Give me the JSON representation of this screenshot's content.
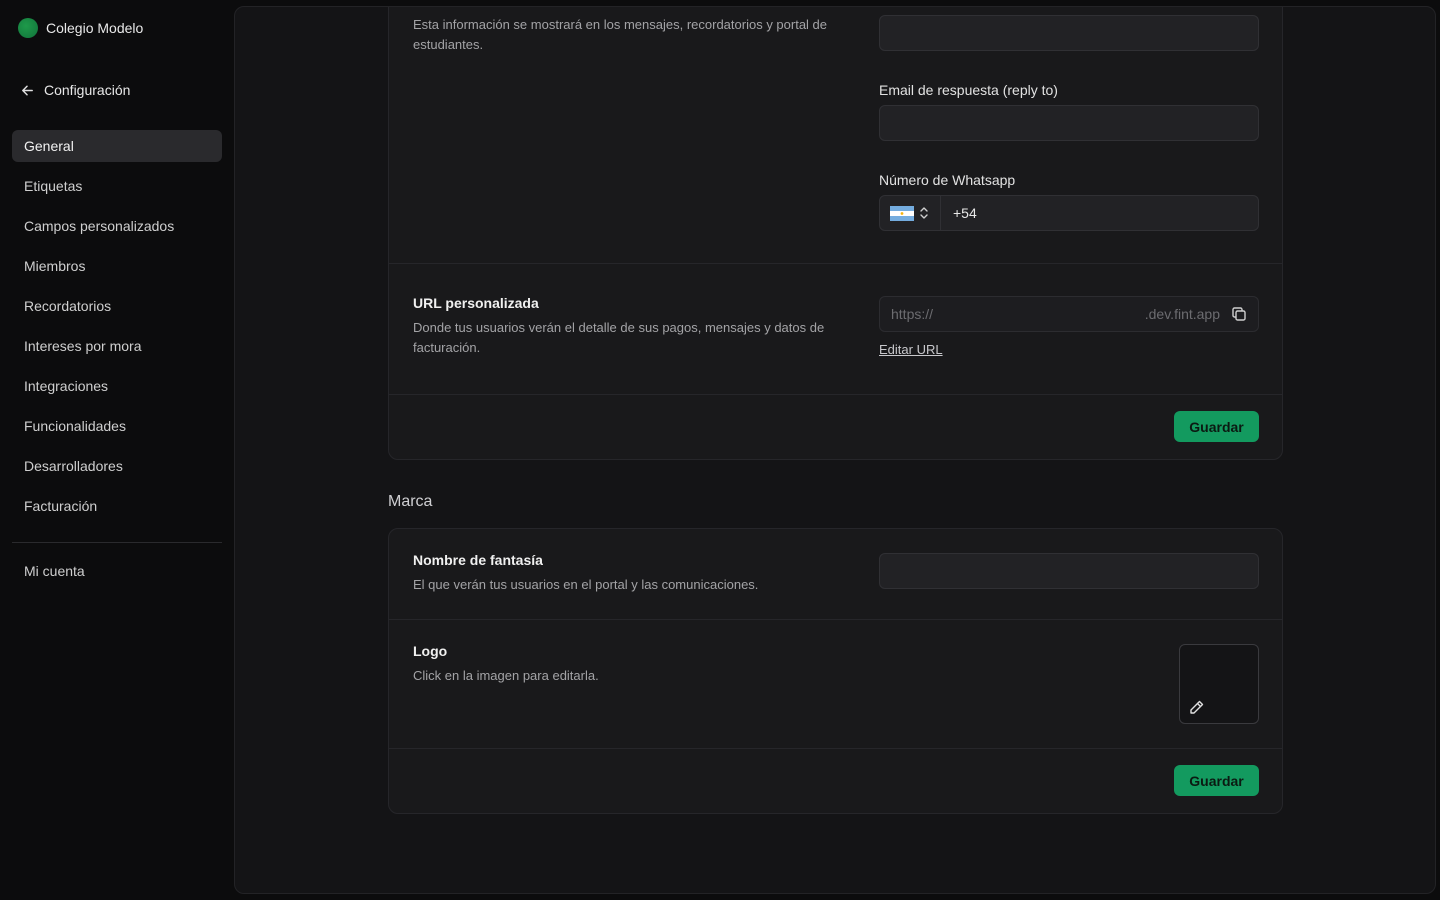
{
  "sidebar": {
    "org_name": "Colegio Modelo",
    "back_label": "Configuración",
    "items": [
      {
        "label": "General",
        "active": true
      },
      {
        "label": "Etiquetas"
      },
      {
        "label": "Campos personalizados"
      },
      {
        "label": "Miembros"
      },
      {
        "label": "Recordatorios"
      },
      {
        "label": "Intereses por mora"
      },
      {
        "label": "Integraciones"
      },
      {
        "label": "Funcionalidades"
      },
      {
        "label": "Desarrolladores"
      },
      {
        "label": "Facturación"
      }
    ],
    "account_label": "Mi cuenta"
  },
  "contact": {
    "description": "Esta información se mostrará en los mensajes, recordatorios y portal de estudiantes.",
    "email_field_value": "",
    "reply_to_label": "Email de respuesta (reply to)",
    "reply_to_value": "",
    "whatsapp_label": "Número de Whatsapp",
    "whatsapp_country": "Argentina",
    "whatsapp_value": "+54"
  },
  "custom_url": {
    "title": "URL personalizada",
    "description": "Donde tus usuarios verán el detalle de sus pagos, mensajes y datos de facturación.",
    "prefix": "https://",
    "suffix": ".dev.fint.app",
    "edit_link": "Editar URL"
  },
  "save_label": "Guardar",
  "brand": {
    "section_title": "Marca",
    "fantasy_name_title": "Nombre de fantasía",
    "fantasy_name_desc": "El que verán tus usuarios en el portal y las comunicaciones.",
    "fantasy_name_value": "",
    "logo_title": "Logo",
    "logo_desc": "Click en la imagen para editarla."
  },
  "colors": {
    "accent": "#139a5f",
    "background": "#0c0c0d",
    "panel": "#141416",
    "card": "#19191b"
  }
}
